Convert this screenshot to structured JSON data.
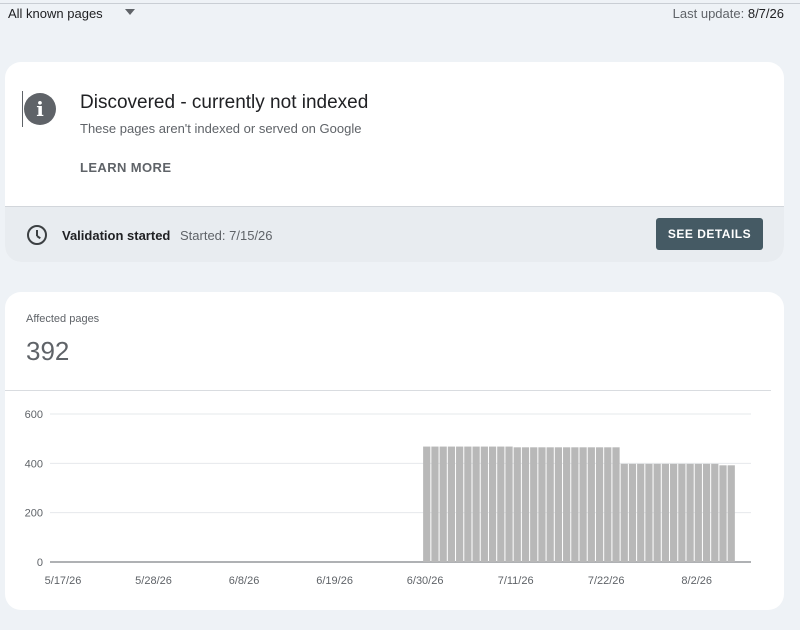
{
  "header": {
    "filter_label": "All known pages",
    "last_update_label": "Last update:",
    "last_update_value": "8/7/26"
  },
  "issue": {
    "title": "Discovered - currently not indexed",
    "description": "These pages aren't indexed or served on Google",
    "learn_more": "LEARN MORE",
    "validation_status": "Validation started",
    "validation_started": "Started: 7/15/26",
    "details_button": "SEE DETAILS",
    "icon": "info-icon"
  },
  "metric": {
    "label": "Affected pages",
    "value": "392"
  },
  "chart_data": {
    "type": "bar",
    "x_tick_labels": [
      "5/17/26",
      "5/28/26",
      "6/8/26",
      "6/19/26",
      "6/30/26",
      "7/11/26",
      "7/22/26",
      "8/2/26"
    ],
    "y_tick_labels": [
      "0",
      "200",
      "400",
      "600"
    ],
    "ylim": [
      0,
      600
    ],
    "grid": true,
    "bar_color": "#b8b8b8",
    "start_date": "5/17/26",
    "categories": [
      "6/30/26",
      "7/1/26",
      "7/2/26",
      "7/3/26",
      "7/4/26",
      "7/5/26",
      "7/6/26",
      "7/7/26",
      "7/8/26",
      "7/9/26",
      "7/10/26",
      "7/11/26",
      "7/12/26",
      "7/13/26",
      "7/14/26",
      "7/15/26",
      "7/16/26",
      "7/17/26",
      "7/18/26",
      "7/19/26",
      "7/20/26",
      "7/21/26",
      "7/22/26",
      "7/23/26",
      "7/24/26",
      "7/25/26",
      "7/26/26",
      "7/27/26",
      "7/28/26",
      "7/29/26",
      "7/30/26",
      "7/31/26",
      "8/1/26",
      "8/2/26",
      "8/3/26",
      "8/4/26",
      "8/5/26",
      "8/6/26"
    ],
    "values": [
      468,
      468,
      468,
      468,
      468,
      468,
      468,
      468,
      468,
      468,
      468,
      465,
      465,
      465,
      465,
      465,
      465,
      465,
      465,
      465,
      465,
      465,
      465,
      465,
      398,
      398,
      398,
      398,
      398,
      398,
      398,
      398,
      398,
      398,
      398,
      398,
      392,
      392
    ]
  }
}
